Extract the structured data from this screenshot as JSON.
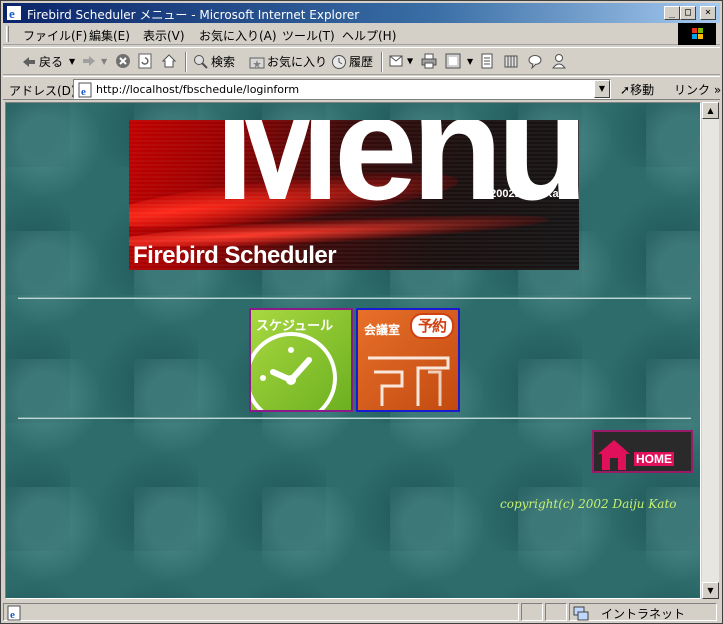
{
  "window": {
    "title": "Firebird Scheduler メニュー - Microsoft Internet Explorer",
    "controls": {
      "minimize": "_",
      "maximize": "□",
      "close": "×"
    }
  },
  "menubar": {
    "items": [
      "ファイル(F)",
      "編集(E)",
      "表示(V)",
      "お気に入り(A)",
      "ツール(T)",
      "ヘルプ(H)"
    ]
  },
  "toolbar": {
    "back": "戻る",
    "search": "検索",
    "favorites": "お気に入り",
    "history": "履歴"
  },
  "addressbar": {
    "label": "アドレス(D)",
    "url": "http://localhost/fbschedule/loginform",
    "go": "移動",
    "links": "リンク »"
  },
  "page": {
    "banner": {
      "heading": "Menu",
      "copyright": "©2002Daiju Kato",
      "product": "Firebird Scheduler"
    },
    "tiles": {
      "schedule_label": "スケジュール",
      "room_label": "会議室",
      "room_badge": "予約"
    },
    "home_label": "HOME",
    "copyright": "copyright(c) 2002 Daiju Kato"
  },
  "statusbar": {
    "zone": "イントラネット"
  },
  "colors": {
    "title_bar": "#0a246a",
    "chrome": "#d4d0c8",
    "page_bg": "#2e6b6b",
    "copyright_text": "#c8f070"
  }
}
